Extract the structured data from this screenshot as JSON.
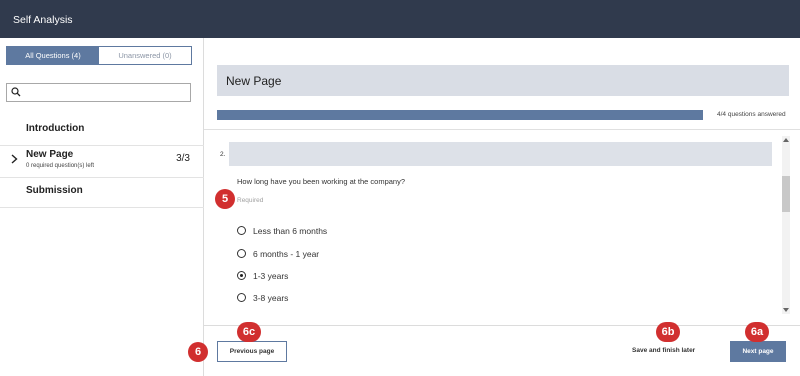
{
  "app": {
    "title": "Self Analysis"
  },
  "sidebar": {
    "tabs": [
      {
        "label": "All Questions (4)",
        "active": true
      },
      {
        "label": "Unanswered (0)",
        "active": false
      }
    ],
    "search": {
      "placeholder": ""
    },
    "items": [
      {
        "label": "Introduction",
        "sub": "",
        "count": ""
      },
      {
        "label": "New Page",
        "sub": "0 required question(s) left",
        "count": "3/3"
      },
      {
        "label": "Submission",
        "sub": "",
        "count": ""
      }
    ]
  },
  "main": {
    "page_title": "New Page",
    "progress_text": "4/4 questions answered",
    "progress_fraction": 1.0,
    "question": {
      "number": "2.",
      "text": "How long have you been working at the company?",
      "required": "Required",
      "options": [
        {
          "label": "Less than 6 months",
          "checked": false
        },
        {
          "label": "6 months - 1 year",
          "checked": false
        },
        {
          "label": "1-3 years",
          "checked": true
        },
        {
          "label": "3-8 years",
          "checked": false
        }
      ]
    }
  },
  "footer": {
    "prev": "Previous page",
    "save": "Save and finish later",
    "next": "Next page"
  },
  "markers": {
    "m5": "5",
    "m6": "6",
    "m6c": "6c",
    "m6b": "6b",
    "m6a": "6a"
  },
  "colors": {
    "topbar": "#303a4d",
    "accent": "#5e79a0",
    "marker": "#d12f2f"
  }
}
